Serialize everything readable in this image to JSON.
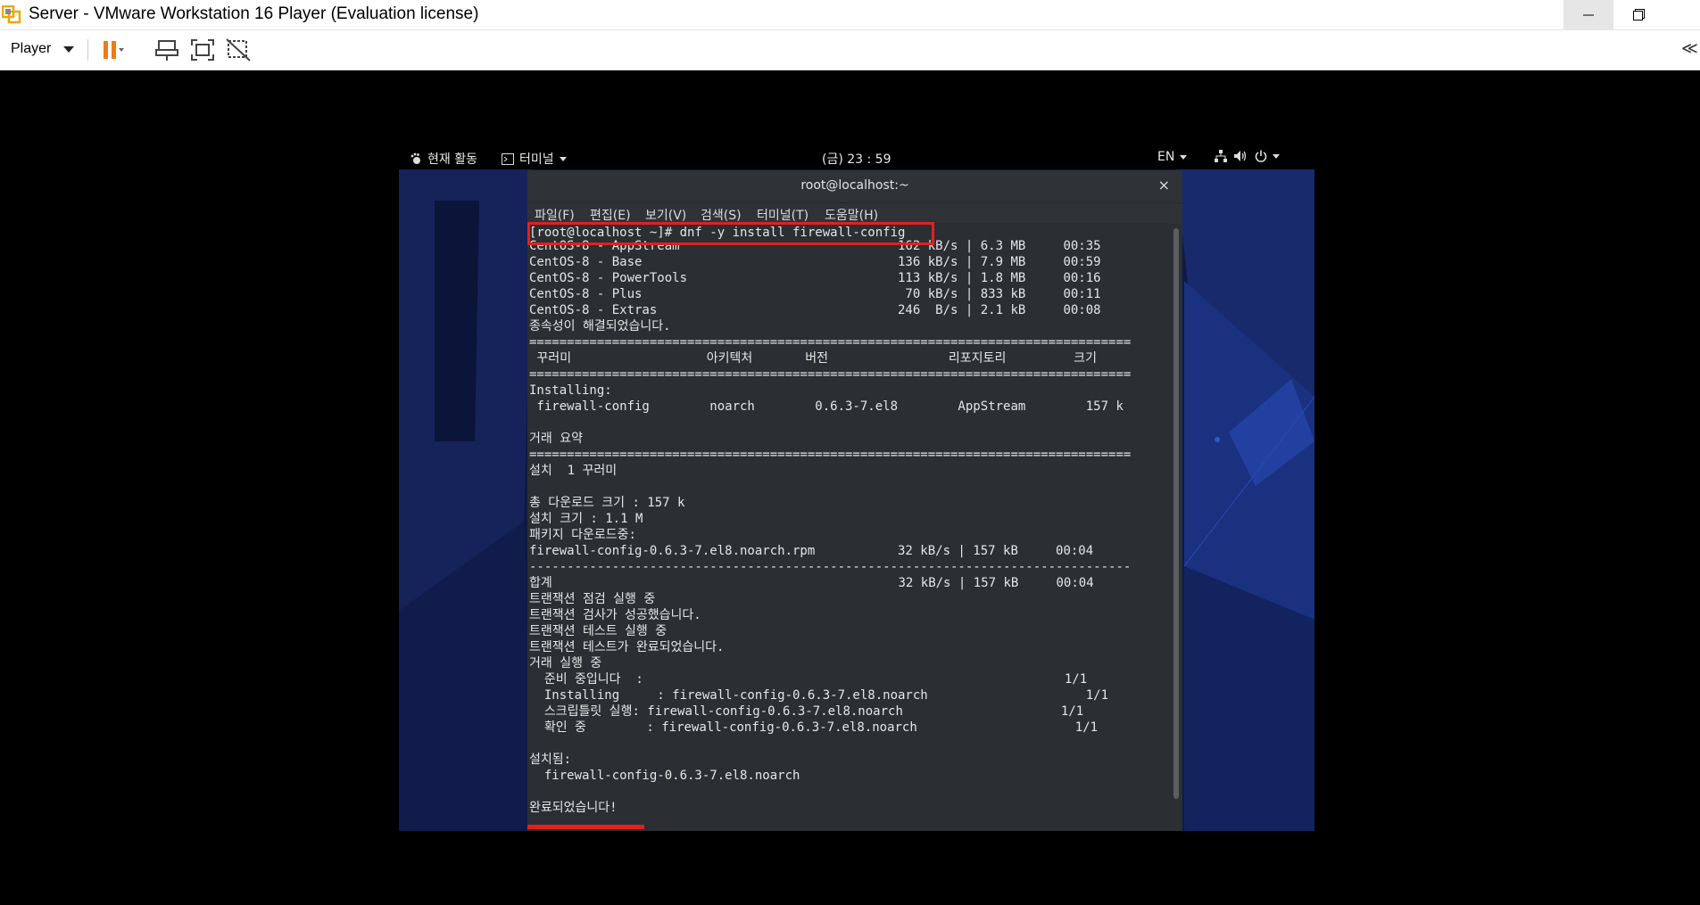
{
  "window": {
    "title": "Server - VMware Workstation 16 Player (Evaluation license)"
  },
  "toolbar": {
    "player_label": "Player",
    "collapse_glyph": "≪"
  },
  "gnome": {
    "activities": "현재 활동",
    "app_menu": "터미널",
    "clock": "(금) 23 : 59",
    "input_method": "EN"
  },
  "terminal": {
    "title": "root@localhost:~",
    "close_glyph": "×",
    "menu": [
      "파일(F)",
      "편집(E)",
      "보기(V)",
      "검색(S)",
      "터미널(T)",
      "도움말(H)"
    ],
    "lines": [
      "[root@localhost ~]# dnf -y install firewall-config",
      "CentOS-8 - AppStream                             162 kB/s | 6.3 MB     00:35",
      "CentOS-8 - Base                                  136 kB/s | 7.9 MB     00:59",
      "CentOS-8 - PowerTools                            113 kB/s | 1.8 MB     00:16",
      "CentOS-8 - Plus                                   70 kB/s | 833 kB     00:11",
      "CentOS-8 - Extras                                246  B/s | 2.1 kB     00:08",
      "종속성이 해결되었습니다.",
      "================================================================================",
      " 꾸러미                  아키텍처       버전                리포지토리         크기",
      "================================================================================",
      "Installing:",
      " firewall-config        noarch        0.6.3-7.el8        AppStream        157 k",
      "",
      "거래 요약",
      "================================================================================",
      "설치  1 꾸러미",
      "",
      "총 다운로드 크기 : 157 k",
      "설치 크기 : 1.1 M",
      "패키지 다운로드중:",
      "firewall-config-0.6.3-7.el8.noarch.rpm           32 kB/s | 157 kB     00:04",
      "--------------------------------------------------------------------------------",
      "합계                                              32 kB/s | 157 kB     00:04",
      "트랜잭션 점검 실행 중",
      "트랜잭션 검사가 성공했습니다.",
      "트랜잭션 테스트 실행 중",
      "트랜잭션 테스트가 완료되었습니다.",
      "거래 실행 중",
      "  준비 중입니다  :                                                        1/1",
      "  Installing     : firewall-config-0.6.3-7.el8.noarch                     1/1",
      "  스크립틀릿 실행: firewall-config-0.6.3-7.el8.noarch                     1/1",
      "  확인 중        : firewall-config-0.6.3-7.el8.noarch                     1/1",
      "",
      "설치됨:",
      "  firewall-config-0.6.3-7.el8.noarch",
      "",
      "완료되었습니다!"
    ]
  },
  "colors": {
    "highlight": "#e32020",
    "terminal_bg": "#2b2e33",
    "desktop_bg": "#0e1a44"
  }
}
